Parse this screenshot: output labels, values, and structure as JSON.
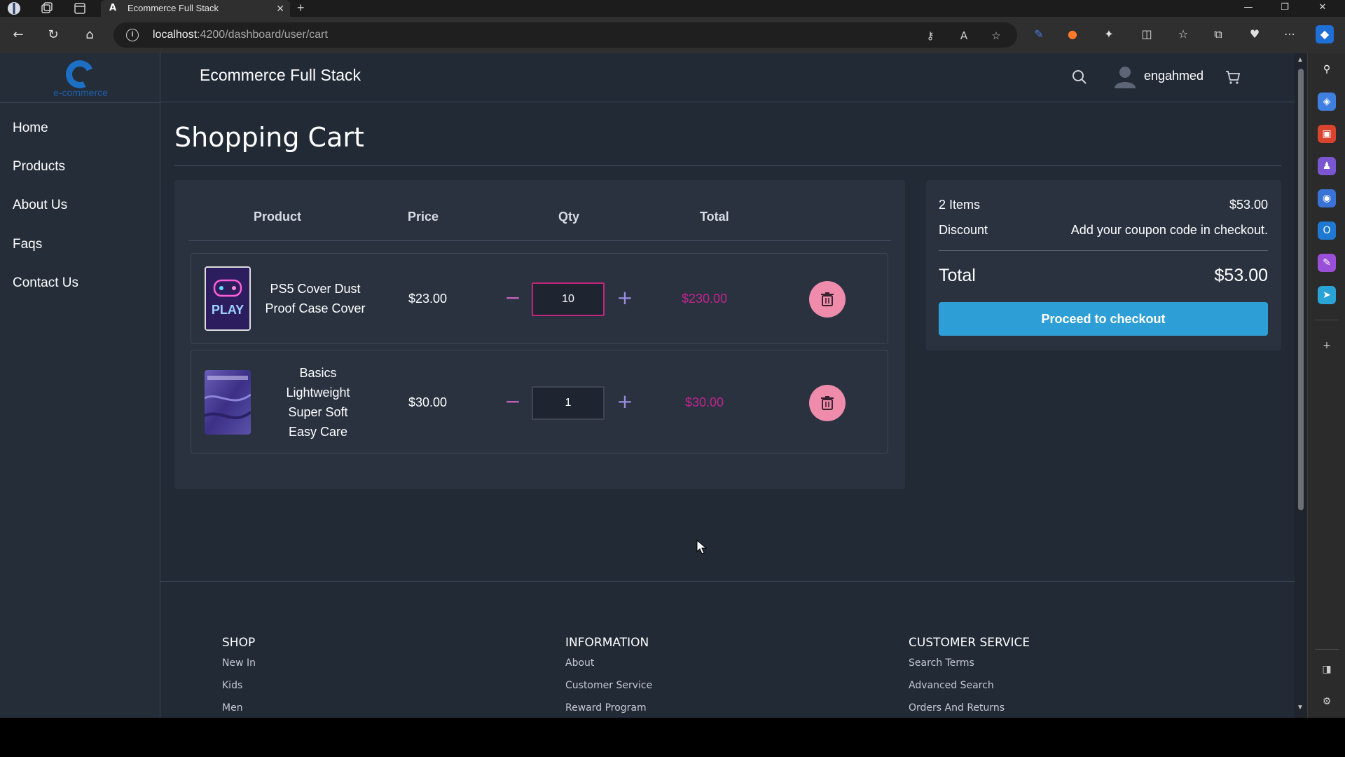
{
  "browser": {
    "tab_title": "Ecommerce Full Stack",
    "url_host": "localhost",
    "url_path": ":4200/dashboard/user/cart"
  },
  "app": {
    "title": "Ecommerce Full Stack",
    "logo_text": "e-commerce",
    "username": "engahmed"
  },
  "sidebar": {
    "items": [
      {
        "label": "Home"
      },
      {
        "label": "Products"
      },
      {
        "label": "About Us"
      },
      {
        "label": "Faqs"
      },
      {
        "label": "Contact Us"
      }
    ]
  },
  "cart": {
    "title": "Shopping Cart",
    "columns": {
      "product": "Product",
      "price": "Price",
      "qty": "Qty",
      "total": "Total"
    },
    "items": [
      {
        "name": "PS5 Cover Dust Proof Case Cover",
        "price": "$23.00",
        "qty": "10",
        "total": "$230.00",
        "image_text": "PLAY"
      },
      {
        "name": "Basics Lightweight Super Soft Easy Care",
        "price": "$30.00",
        "qty": "1",
        "total": "$30.00"
      }
    ]
  },
  "summary": {
    "items_label": "2 Items",
    "items_value": "$53.00",
    "discount_label": "Discount",
    "discount_value": "Add your coupon code in checkout.",
    "total_label": "Total",
    "total_value": "$53.00",
    "checkout_label": "Proceed to checkout"
  },
  "footer": {
    "shop": {
      "heading": "SHOP",
      "links": [
        "New In",
        "Kids",
        "Men"
      ]
    },
    "information": {
      "heading": "INFORMATION",
      "links": [
        "About",
        "Customer Service",
        "Reward Program"
      ]
    },
    "customer_service": {
      "heading": "CUSTOMER SERVICE",
      "links": [
        "Search Terms",
        "Advanced Search",
        "Orders And Returns"
      ]
    }
  },
  "colors": {
    "page_bg": "#222a36",
    "accent_magenta": "#c0258c",
    "checkout_blue": "#2e9fd6",
    "delete_pink": "#f08cab"
  }
}
